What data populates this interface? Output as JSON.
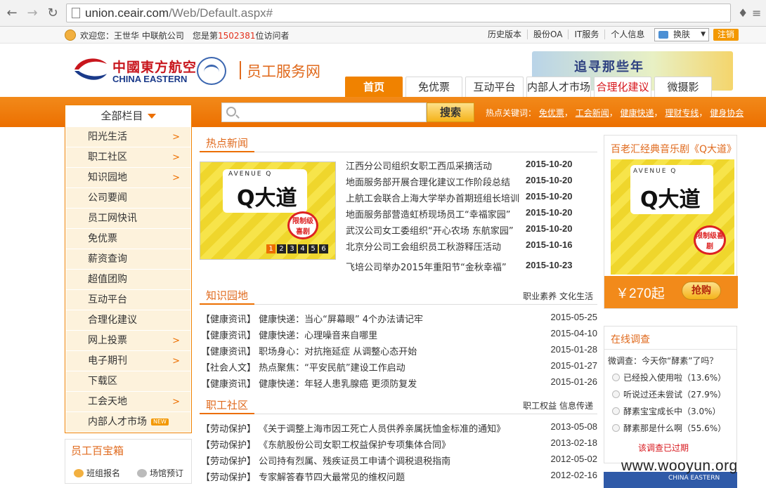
{
  "browser": {
    "url_host": "union.ceair.com",
    "url_path": "/Web/Default.aspx#"
  },
  "topbar": {
    "welcome": "欢迎您：王世华 中联航公司",
    "visitor_prefix": "您是第",
    "visitor_count": "1502381",
    "visitor_suffix": "位访问者",
    "links": [
      "历史版本",
      "股份OA",
      "IT服务",
      "个人信息"
    ],
    "skin_label": "换肤",
    "logout_label": "注销"
  },
  "header": {
    "logo_cn": "中國東方航空",
    "logo_en": "CHINA EASTERN",
    "site_name": "员工服务网",
    "banner_text": "追寻那些年"
  },
  "nav_tabs": [
    {
      "label": "首页",
      "active": true
    },
    {
      "label": "免优票"
    },
    {
      "label": "互动平台"
    },
    {
      "label": "内部人才市场"
    },
    {
      "label": "合理化建议",
      "red": true
    },
    {
      "label": "微摄影"
    }
  ],
  "search": {
    "all_categories": "全部栏目",
    "button": "搜索",
    "hot_label": "热点关键词：",
    "hot_words": [
      "免优票",
      "工会新闻",
      "健康快递",
      "理财专线",
      "健身协会"
    ]
  },
  "sidebar": {
    "items": [
      {
        "label": "阳光生活",
        "arrow": ">"
      },
      {
        "label": "职工社区",
        "arrow": ">"
      },
      {
        "label": "知识园地",
        "arrow": ">"
      },
      {
        "label": "公司要闻"
      },
      {
        "label": "员工网快讯"
      },
      {
        "label": "免优票"
      },
      {
        "label": "薪资查询"
      },
      {
        "label": "超值团购"
      },
      {
        "label": "互动平台"
      },
      {
        "label": "合理化建议"
      },
      {
        "label": "网上投票",
        "arrow": ">"
      },
      {
        "label": "电子期刊",
        "arrow": ">"
      },
      {
        "label": "下载区"
      },
      {
        "label": "工会天地",
        "arrow": ">"
      },
      {
        "label": "内部人才市场",
        "badge": "NEW"
      }
    ]
  },
  "toolbox": {
    "title": "员工百宝箱",
    "items": [
      "班组报名",
      "场馆预订"
    ]
  },
  "hot_news": {
    "title": "热点新闻",
    "slide_numbers": [
      "1",
      "2",
      "3",
      "4",
      "5",
      "6"
    ],
    "poster": {
      "sub": "AVENUE Q",
      "main": "Q大道",
      "badge": "限制级喜剧"
    },
    "items": [
      {
        "title": "江西分公司组织女职工西瓜采摘活动",
        "date": "2015-10-20"
      },
      {
        "title": "地面服务部开展合理化建议工作阶段总结",
        "date": "2015-10-20"
      },
      {
        "title": "上航工会联合上海大学举办首期班组长培训",
        "date": "2015-10-20"
      },
      {
        "title": "地面服务部营造虹桥现场员工“幸福家园”",
        "date": "2015-10-20"
      },
      {
        "title": "武汉公司女工委组织“开心农场 东航家园”",
        "date": "2015-10-20"
      },
      {
        "title": "北京分公司工会组织员工秋游释压活动",
        "date": "2015-10-16"
      },
      {
        "title": "飞培公司举办2015年重阳节“金秋幸福”",
        "date": "2015-10-23"
      }
    ]
  },
  "knowledge": {
    "title": "知识园地",
    "more": [
      "职业素养",
      "文化生活"
    ],
    "items": [
      {
        "title": "【健康资讯】 健康快递：当心“屏幕眼” 4个办法请记牢",
        "date": "2015-05-25"
      },
      {
        "title": "【健康资讯】 健康快递：心理噪音来自哪里",
        "date": "2015-04-10"
      },
      {
        "title": "【健康资讯】 职场身心：对抗拖延症 从调整心态开始",
        "date": "2015-01-28"
      },
      {
        "title": "【社会人文】 热点聚焦：“平安民航”建设工作启动",
        "date": "2015-01-27"
      },
      {
        "title": "【健康资讯】 健康快递：年轻人患乳腺癌 更须防复发",
        "date": "2015-01-26"
      }
    ]
  },
  "community": {
    "title": "职工社区",
    "more": [
      "职工权益",
      "信息传递"
    ],
    "items": [
      {
        "title": "【劳动保护】 《关于调整上海市因工死亡人员供养亲属抚恤金标准的通知》",
        "date": "2013-05-08"
      },
      {
        "title": "【劳动保护】 《东航股份公司女职工权益保护专项集体合同》",
        "date": "2013-02-18"
      },
      {
        "title": "【劳动保护】 公司持有烈属、残疾证员工申请个调税退税指南",
        "date": "2012-05-02"
      },
      {
        "title": "【劳动保护】 专家解答春节四大最常见的维权问题",
        "date": "2012-02-16"
      }
    ]
  },
  "promo": {
    "title": "百老汇经典音乐剧《Q大道》",
    "price": "￥270起",
    "buy": "抢购"
  },
  "survey": {
    "title": "在线调查",
    "question": "微调查：今天你“酵素”了吗？",
    "options": [
      "已经投入使用啦（13.6%）",
      "听说过还未尝试（27.9%）",
      "酵素宝宝成长中（3.0%）",
      "酵素那是什么啊（55.6%）"
    ],
    "expired": "该调查已过期"
  },
  "watermark": "www.wooyun.org",
  "colors": {
    "accent": "#ec6f00",
    "title": "#e06a1d",
    "red": "#d7141a"
  }
}
